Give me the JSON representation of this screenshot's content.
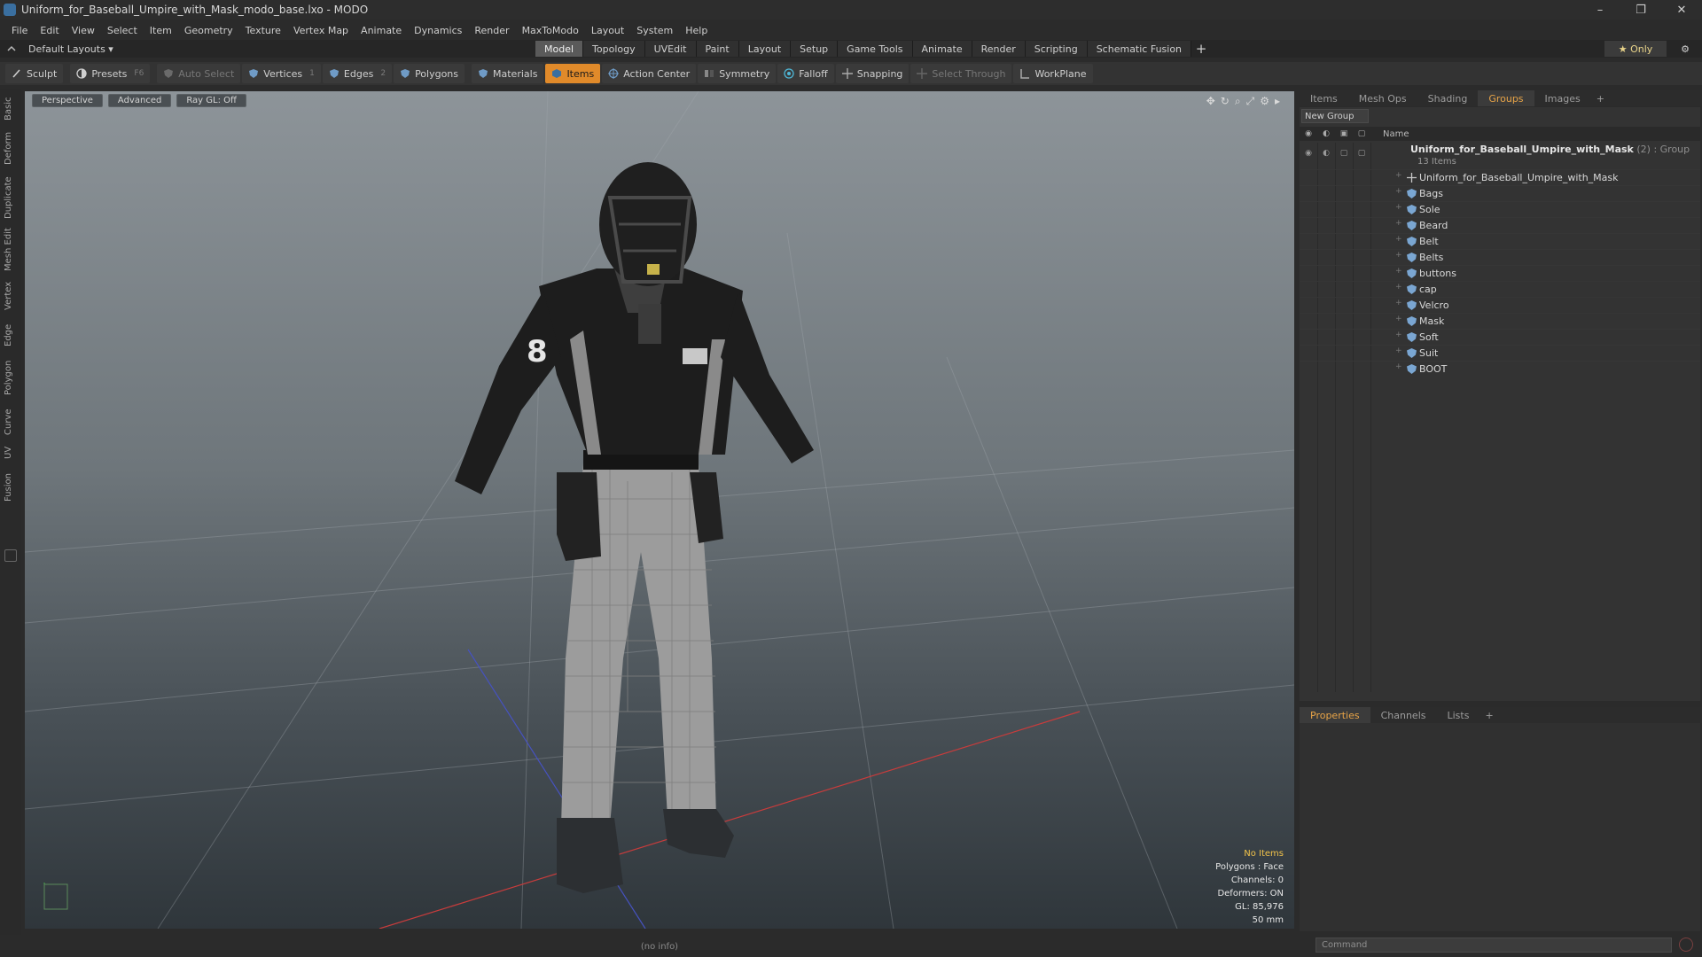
{
  "window": {
    "title": "Uniform_for_Baseball_Umpire_with_Mask_modo_base.lxo - MODO",
    "minimize": "–",
    "restore": "❐",
    "close": "✕"
  },
  "menu": [
    "File",
    "Edit",
    "View",
    "Select",
    "Item",
    "Geometry",
    "Texture",
    "Vertex Map",
    "Animate",
    "Dynamics",
    "Render",
    "MaxToModo",
    "Layout",
    "System",
    "Help"
  ],
  "layout_bar": {
    "layout_select": "Default Layouts ▾",
    "tabs": [
      "Model",
      "Topology",
      "UVEdit",
      "Paint",
      "Layout",
      "Setup",
      "Game Tools",
      "Animate",
      "Render",
      "Scripting",
      "Schematic Fusion"
    ],
    "active_tab": "Model",
    "plus": "+",
    "only": "★  Only",
    "gear": "⚙"
  },
  "toolbar": {
    "sculpt": "Sculpt",
    "presets": "Presets",
    "presets_key": "F6",
    "auto_select": "Auto Select",
    "vertices": "Vertices",
    "vertices_count": "1",
    "edges": "Edges",
    "edges_count": "2",
    "polygons": "Polygons",
    "materials": "Materials",
    "items": "Items",
    "action_center": "Action Center",
    "symmetry": "Symmetry",
    "falloff": "Falloff",
    "snapping": "Snapping",
    "select_through": "Select Through",
    "workplane": "WorkPlane"
  },
  "left_tabs": [
    "Basic",
    "Deform",
    "Duplicate",
    "Mesh Edit",
    "Vertex",
    "Edge",
    "Polygon",
    "Curve",
    "UV",
    "Fusion"
  ],
  "viewport": {
    "view": "Perspective",
    "mode": "Advanced",
    "raygl": "Ray GL: Off",
    "hud": {
      "selection": "No Items",
      "polygons": "Polygons : Face",
      "channels": "Channels: 0",
      "deformers": "Deformers: ON",
      "gl": "GL: 85,976",
      "scale": "50 mm"
    }
  },
  "info_bar": "(no info)",
  "right_panel": {
    "tabs": [
      "Items",
      "Mesh Ops",
      "Shading",
      "Groups",
      "Images"
    ],
    "active_tab": "Groups",
    "plus": "+",
    "new_group": "New Group",
    "column_name": "Name",
    "group": {
      "name": "Uniform_for_Baseball_Umpire_with_Mask",
      "count": " (2) : Group",
      "sub": "13 Items"
    },
    "items": [
      "Uniform_for_Baseball_Umpire_with_Mask",
      "Bags",
      "Sole",
      "Beard",
      "Belt",
      "Belts",
      "buttons",
      "cap",
      "Velcro",
      "Mask",
      "Soft",
      "Suit",
      "BOOT"
    ]
  },
  "properties_panel": {
    "tabs": [
      "Properties",
      "Channels",
      "Lists"
    ],
    "active_tab": "Properties",
    "plus": "+"
  },
  "command": {
    "placeholder": "Command"
  },
  "colors": {
    "accent": "#e08a2a",
    "active_tab_text": "#e8a447",
    "hud_warning": "#f0c24a"
  }
}
